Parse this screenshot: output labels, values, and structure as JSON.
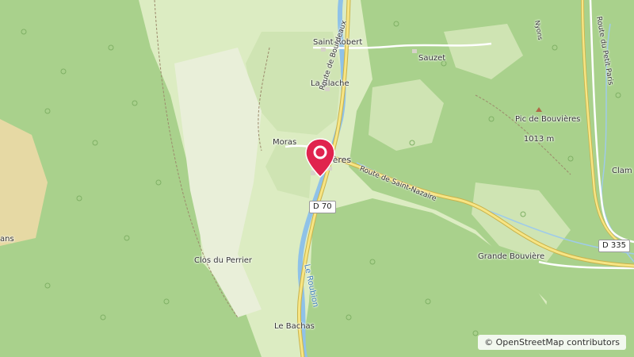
{
  "map": {
    "place_labels": {
      "saint_robert": "Saint-Robert",
      "sauzet": "Sauzet",
      "la_blache": "La Blache",
      "moras": "Moras",
      "bouvieres_partial": "vières",
      "clos_du_perrier": "Clos du Perrier",
      "grande_bouviere": "Grande Bouvière",
      "le_bachas": "Le Bachas",
      "clam_partial": "Clam",
      "ans_partial": "ans"
    },
    "peak": {
      "name": "Pic de Bouvières",
      "elevation": "1013 m"
    },
    "road_labels": {
      "route_de_bourdeaux": "Route de Bourdeaux",
      "route_de_saint_nazaire": "Route de Saint-Nazaire",
      "route_du_petit_paris": "Route du Petit Paris",
      "nyons_partial": "Nyons"
    },
    "road_shields": {
      "d70": "D 70",
      "d335": "D 335"
    },
    "river_label": "Le Roubion",
    "marker_icon": "location-pin-icon",
    "colors": {
      "forest": "#a7d08a",
      "meadow": "#d9ebbf",
      "scrub": "#cde3b2",
      "field": "#e6d9a4",
      "river": "#7fb6e0",
      "road_yellow": "#f5e27a",
      "marker": "#e0244e"
    }
  },
  "attribution": {
    "symbol": "©",
    "text": "OpenStreetMap contributors"
  }
}
